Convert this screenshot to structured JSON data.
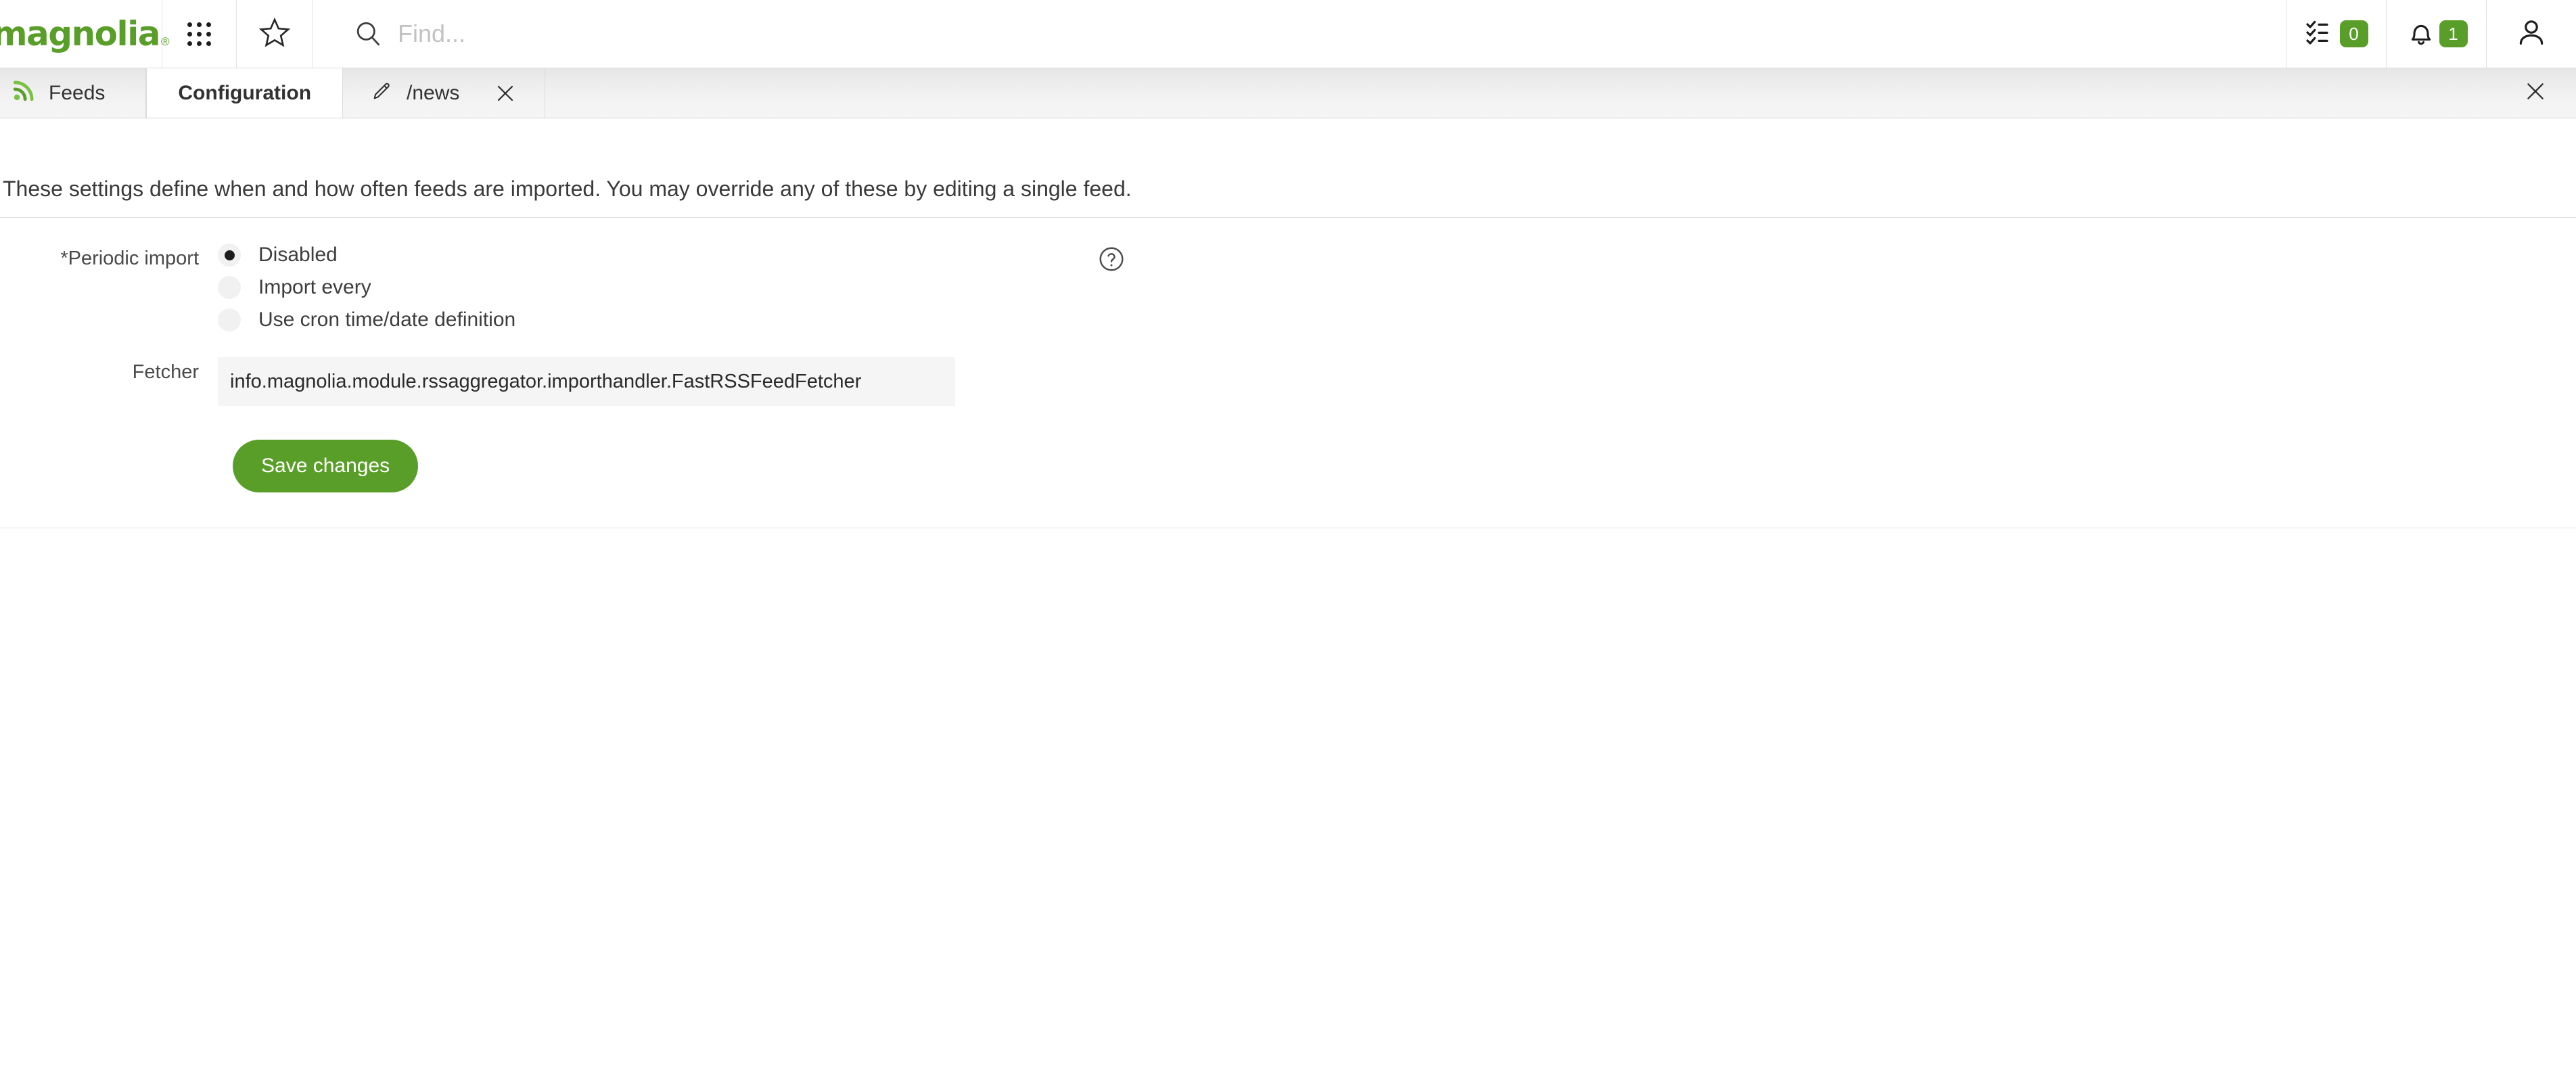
{
  "header": {
    "logo_text": "magnolia",
    "logo_registered": "®",
    "apps_icon": "grid-apps-icon",
    "favorites_icon": "star-icon",
    "search": {
      "placeholder": "Find...",
      "value": "",
      "icon": "search-icon"
    },
    "tasks": {
      "icon": "tasks-checklist-icon",
      "badge": "0"
    },
    "notifications": {
      "icon": "bell-icon",
      "badge": "1"
    },
    "user": {
      "icon": "user-avatar-icon"
    }
  },
  "tabbar": {
    "tabs": [
      {
        "label": "Feeds",
        "icon": "rss-feed-icon",
        "active": false,
        "closable": false
      },
      {
        "label": "Configuration",
        "icon": "",
        "active": true,
        "closable": false
      },
      {
        "label": "/news",
        "icon": "pencil-edit-icon",
        "active": false,
        "closable": true
      }
    ],
    "close_all_icon": "close-icon"
  },
  "main": {
    "intro": "These settings define when and how often feeds are imported. You may override any of these by editing a single feed.",
    "fields": {
      "periodic_import": {
        "label": "*Periodic import",
        "help_icon": "help-question-icon",
        "options": [
          {
            "label": "Disabled",
            "selected": true
          },
          {
            "label": "Import every",
            "selected": false
          },
          {
            "label": "Use cron time/date definition",
            "selected": false
          }
        ]
      },
      "fetcher": {
        "label": "Fetcher",
        "value": "info.magnolia.module.rssaggregator.importhandler.FastRSSFeedFetcher",
        "placeholder": ""
      }
    },
    "save_button": "Save changes"
  },
  "colors": {
    "brand_green": "#5a9e2a",
    "text_dark": "#3a3a3a",
    "input_bg": "#f5f5f5",
    "divider": "#e1e1e1"
  }
}
